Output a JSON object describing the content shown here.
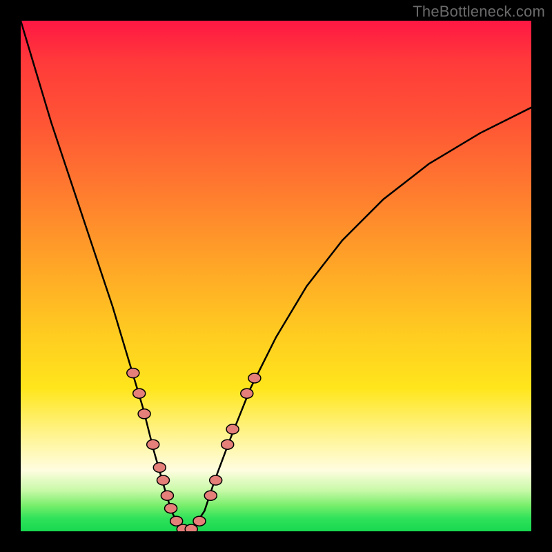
{
  "watermark": "TheBottleneck.com",
  "colors": {
    "frame": "#000000",
    "curve_stroke": "#000000",
    "marker_fill": "#e57f79",
    "marker_stroke": "#000000",
    "gradient_top": "#ff1744",
    "gradient_bottom": "#18d850"
  },
  "chart_data": {
    "type": "line",
    "title": "",
    "xlabel": "",
    "ylabel": "",
    "xlim": [
      0,
      100
    ],
    "ylim": [
      0,
      100
    ],
    "grid": false,
    "legend": false,
    "note": "V-shaped bottleneck curve; y-axis is mismatch/bottleneck (top=worst, bottom=best). No axis ticks or labels are rendered in the image, so values are estimated from pixel positions.",
    "series": [
      {
        "name": "bottleneck-curve",
        "x": [
          0,
          3,
          6,
          10,
          14,
          18,
          21,
          24,
          26,
          28,
          29.5,
          31,
          32,
          33,
          34,
          36,
          38,
          41,
          45,
          50,
          56,
          63,
          71,
          80,
          90,
          100
        ],
        "y": [
          100,
          90,
          80,
          68,
          56,
          44,
          34,
          24,
          16,
          9,
          4,
          1,
          0.3,
          0.3,
          1,
          4,
          10,
          18,
          28,
          38,
          48,
          57,
          65,
          72,
          78,
          83
        ]
      }
    ],
    "markers": [
      {
        "x": 22.0,
        "y": 31.0
      },
      {
        "x": 23.2,
        "y": 27.0
      },
      {
        "x": 24.2,
        "y": 23.0
      },
      {
        "x": 25.9,
        "y": 17.0
      },
      {
        "x": 27.2,
        "y": 12.5
      },
      {
        "x": 27.9,
        "y": 10.0
      },
      {
        "x": 28.7,
        "y": 7.0
      },
      {
        "x": 29.4,
        "y": 4.5
      },
      {
        "x": 30.5,
        "y": 2.0
      },
      {
        "x": 31.8,
        "y": 0.4
      },
      {
        "x": 33.4,
        "y": 0.4
      },
      {
        "x": 35.0,
        "y": 2.0
      },
      {
        "x": 37.2,
        "y": 7.0
      },
      {
        "x": 38.2,
        "y": 10.0
      },
      {
        "x": 40.5,
        "y": 17.0
      },
      {
        "x": 41.5,
        "y": 20.0
      },
      {
        "x": 44.3,
        "y": 27.0
      },
      {
        "x": 45.8,
        "y": 30.0
      }
    ]
  }
}
